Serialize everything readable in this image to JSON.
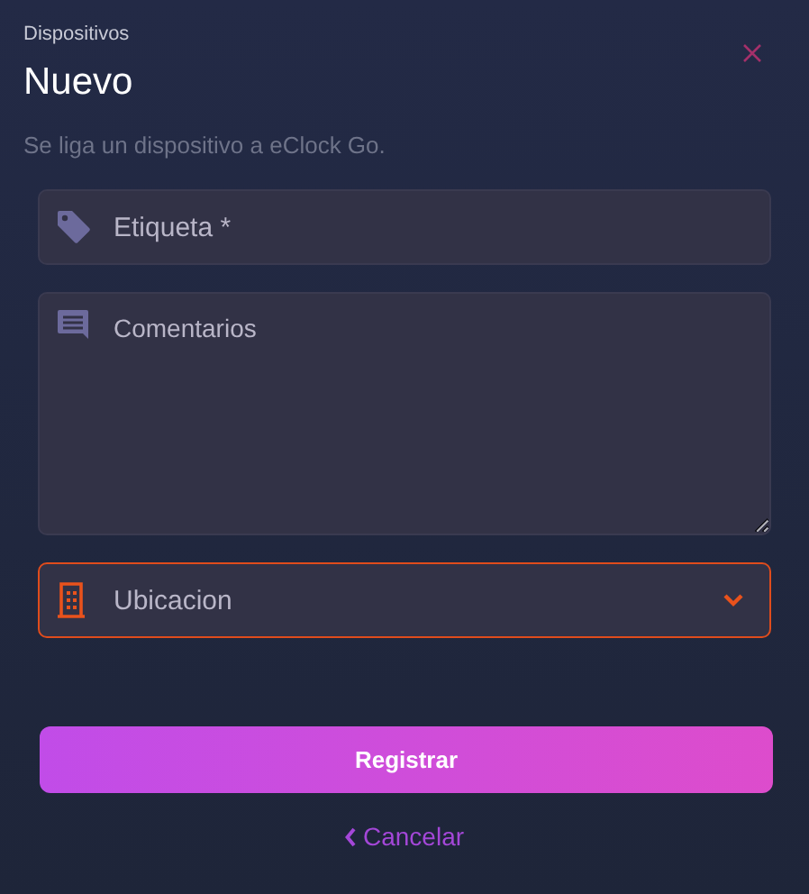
{
  "breadcrumb": "Dispositivos",
  "title": "Nuevo",
  "subtitle": "Se liga un dispositivo a eClock Go.",
  "fields": [
    {
      "kind": "text",
      "placeholder": "Etiqueta *",
      "highlighted": false
    },
    {
      "kind": "textarea",
      "placeholder": "Comentarios",
      "highlighted": false
    },
    {
      "kind": "select",
      "placeholder": "Ubicacion",
      "highlighted": true
    }
  ],
  "submit_button": "Registrar",
  "cancel_link": "Cancelar"
}
